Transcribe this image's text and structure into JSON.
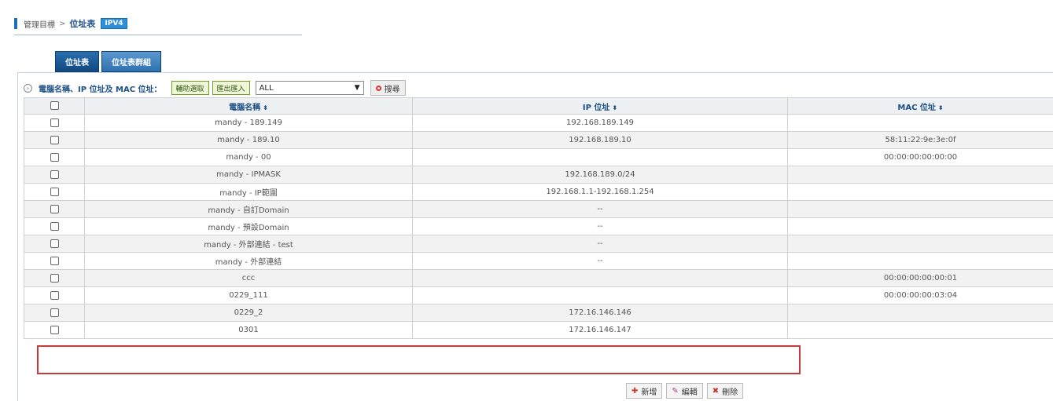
{
  "breadcrumb": {
    "parent": "管理目標",
    "separator": ">",
    "current": "位址表",
    "badge": "IPV4"
  },
  "tabs": [
    {
      "label": "位址表",
      "active": true
    },
    {
      "label": "位址表群組",
      "active": false
    }
  ],
  "filter": {
    "expand_icon": "expand-circle-icon",
    "label": "電腦名稱、IP 位址及 MAC 位址：",
    "btn_assist": "輔助選取",
    "btn_import": "匯出匯入",
    "select_value": "ALL",
    "search_label": "搜尋"
  },
  "table": {
    "columns": [
      "",
      "電腦名稱",
      "IP 位址",
      "MAC 位址"
    ],
    "sort_glyph": "⬍",
    "rows": [
      {
        "name": "mandy - 189.149",
        "ip": "192.168.189.149",
        "mac": ""
      },
      {
        "name": "mandy - 189.10",
        "ip": "192.168.189.10",
        "mac": "58:11:22:9e:3e:0f"
      },
      {
        "name": "mandy - 00",
        "ip": "",
        "mac": "00:00:00:00:00:00"
      },
      {
        "name": "mandy - IPMASK",
        "ip": "192.168.189.0/24",
        "mac": ""
      },
      {
        "name": "mandy - IP範圍",
        "ip": "192.168.1.1-192.168.1.254",
        "mac": ""
      },
      {
        "name": "mandy - 自訂Domain",
        "ip": "--",
        "mac": ""
      },
      {
        "name": "mandy - 預設Domain",
        "ip": "--",
        "mac": ""
      },
      {
        "name": "mandy - 外部連結 - test",
        "ip": "--",
        "mac": ""
      },
      {
        "name": "mandy - 外部連結",
        "ip": "--",
        "mac": ""
      },
      {
        "name": "ccc",
        "ip": "",
        "mac": "00:00:00:00:00:01"
      },
      {
        "name": "0229_111",
        "ip": "",
        "mac": "00:00:00:00:03:04"
      },
      {
        "name": "0229_2",
        "ip": "172.16.146.146",
        "mac": ""
      },
      {
        "name": "0301",
        "ip": "172.16.146.147",
        "mac": ""
      }
    ]
  },
  "highlight_row_index": 12,
  "actions": {
    "add": "新增",
    "edit": "編輯",
    "delete": "刪除"
  },
  "colors": {
    "accent": "#1f6fb5",
    "highlight": "#c8393a"
  }
}
